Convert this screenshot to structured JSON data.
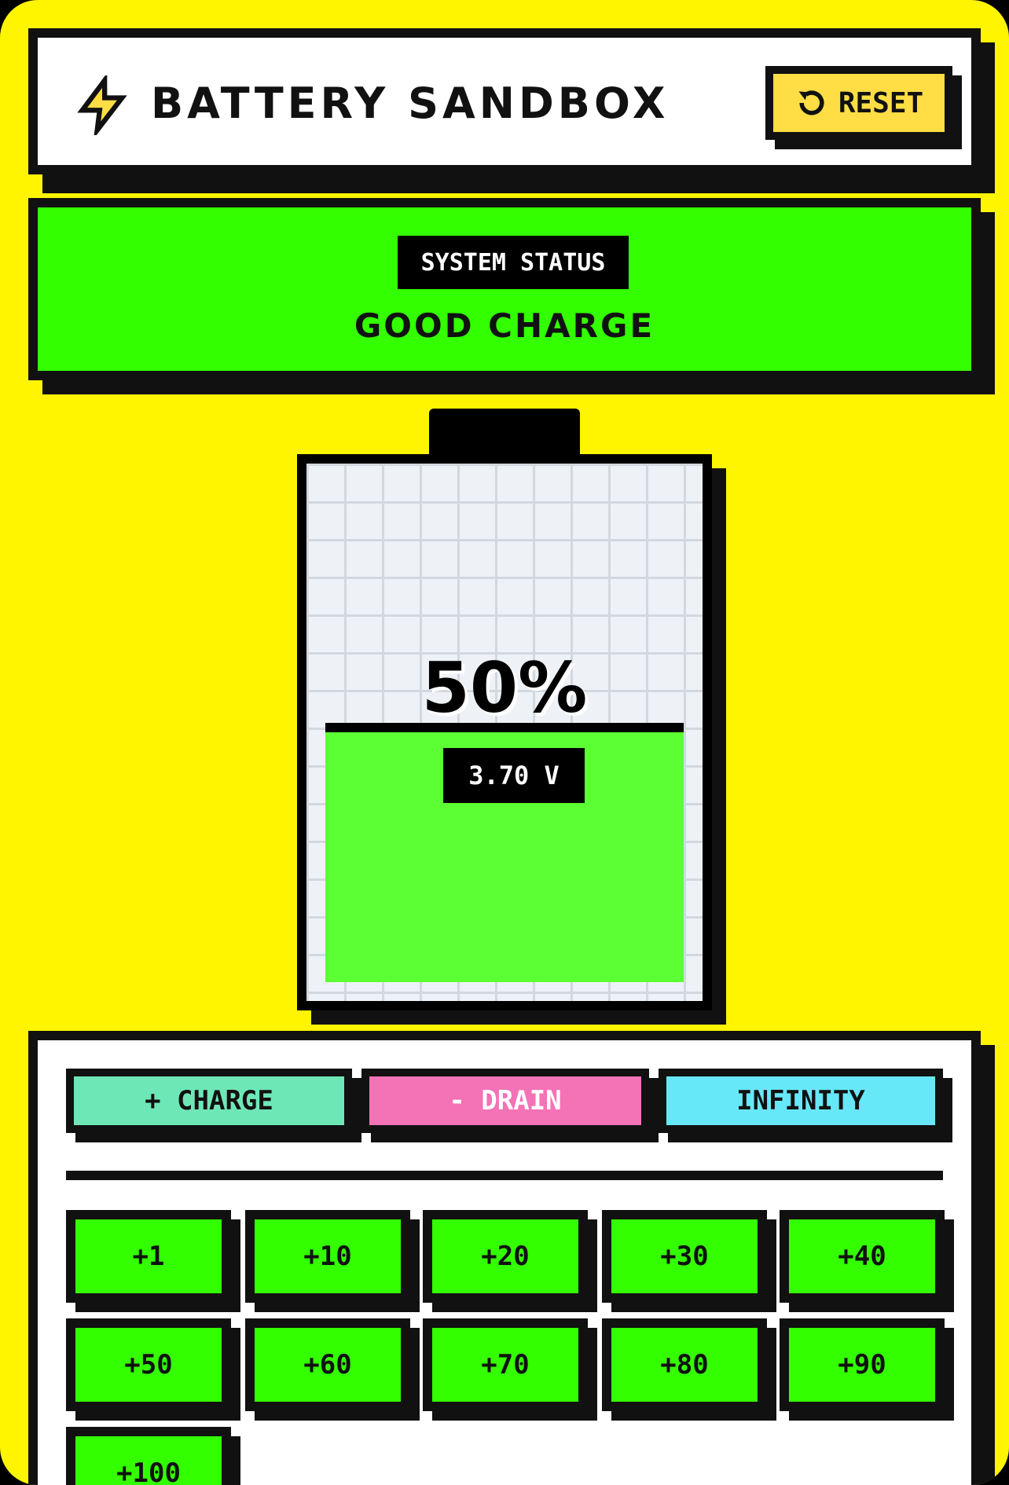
{
  "app": {
    "title": "BATTERY SANDBOX",
    "bolt_icon": "lightning-bolt-icon"
  },
  "header": {
    "reset_label": "RESET",
    "reset_icon": "refresh-icon"
  },
  "status": {
    "tag": "SYSTEM STATUS",
    "value": "GOOD CHARGE",
    "color": "#33FF00"
  },
  "battery": {
    "level": 0.5,
    "percent_text": "50%",
    "voltage": "3.70 V",
    "fill_color": "#5CFF33"
  },
  "modes": [
    {
      "label": "+ CHARGE",
      "color": "#6EE7B7"
    },
    {
      "label": "- DRAIN",
      "color": "#F472B6",
      "text_color": "#FFFFFF"
    },
    {
      "label": "INFINITY",
      "color": "#67E8F9"
    }
  ],
  "increments": [
    "+1",
    "+10",
    "+20",
    "+30",
    "+40",
    "+50",
    "+60",
    "+70",
    "+80",
    "+90",
    "+100"
  ],
  "colors": {
    "background": "#FFF500",
    "accent": "#FFDD44",
    "ink": "#111111"
  }
}
